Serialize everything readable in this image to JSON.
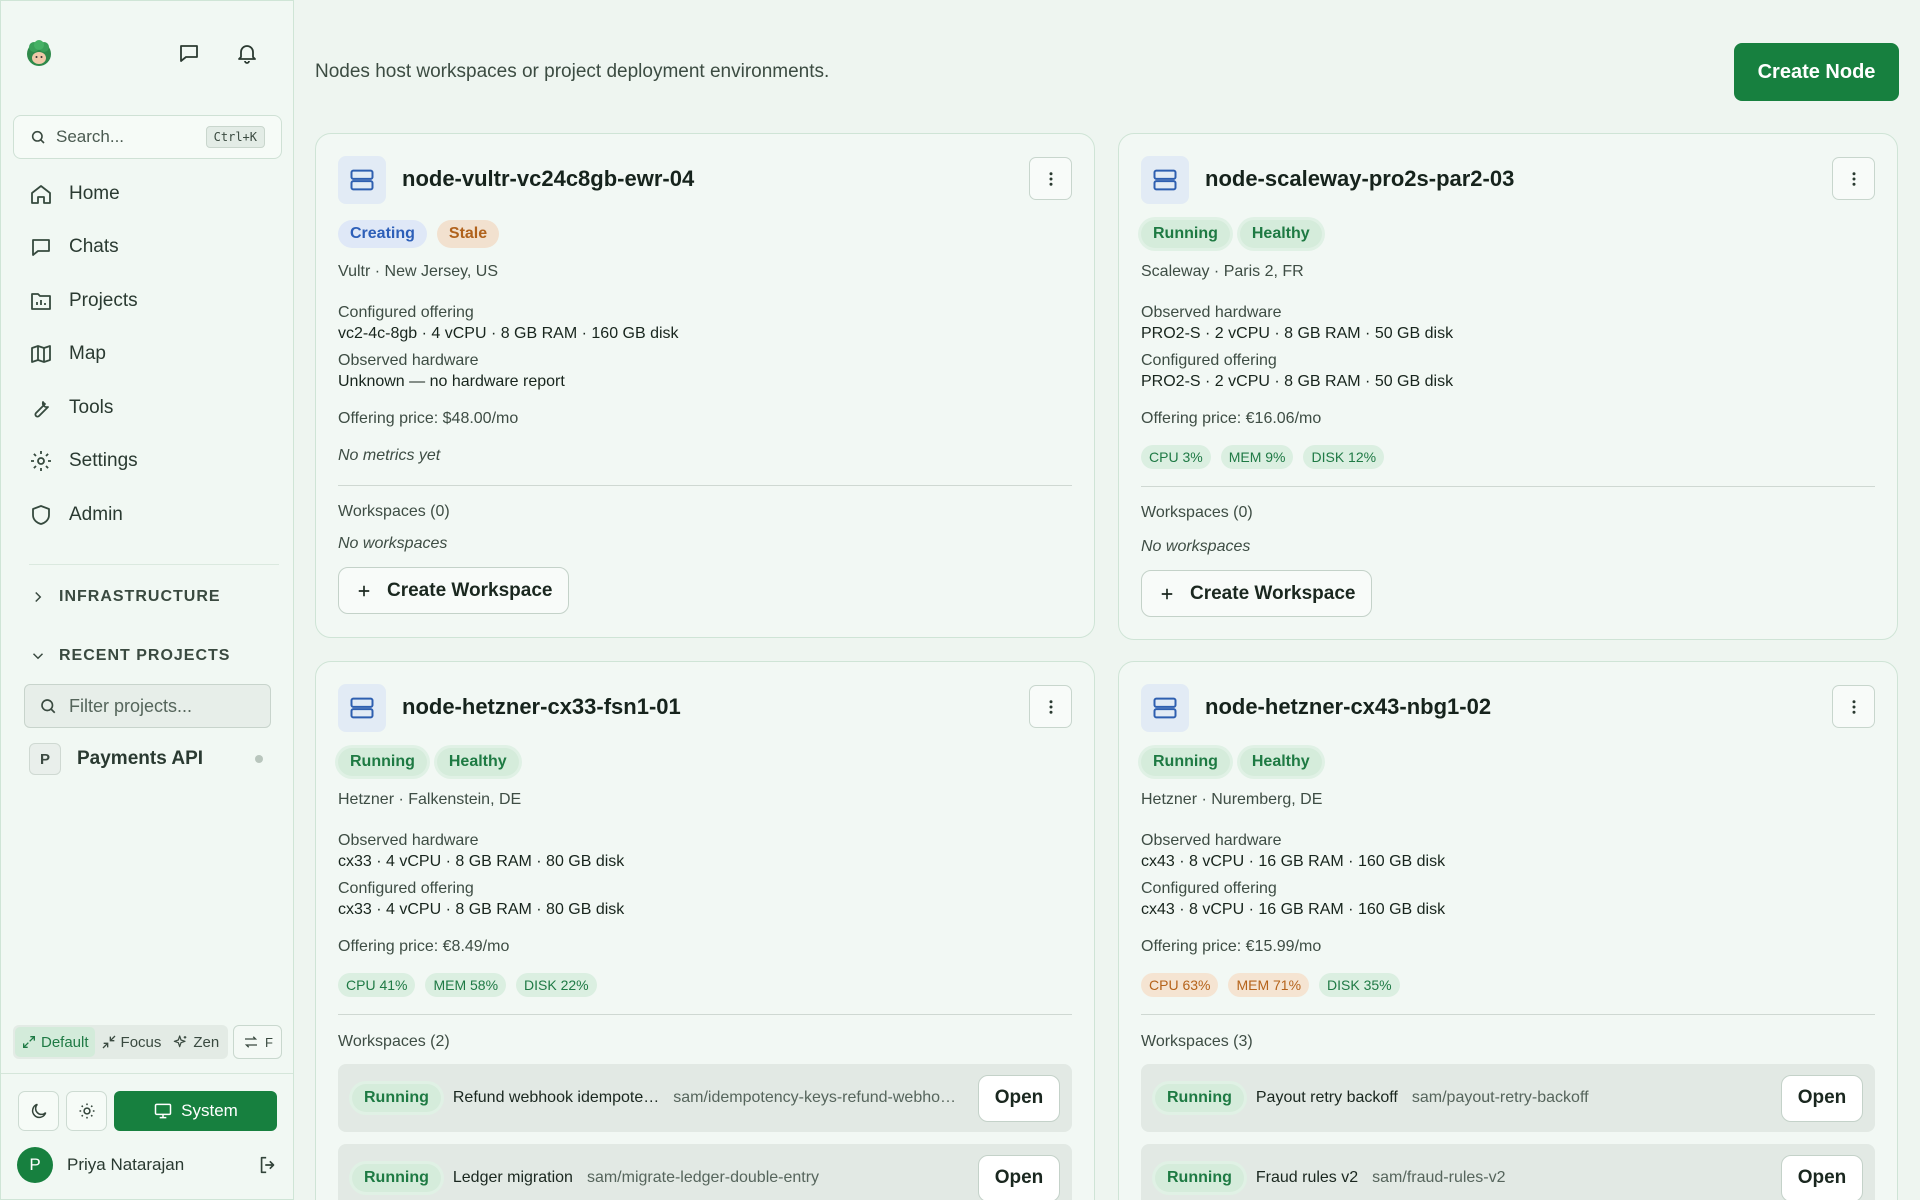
{
  "header": {
    "subtitle": "Nodes host workspaces or project deployment environments.",
    "create_node_label": "Create Node"
  },
  "sidebar": {
    "search_placeholder": "Search...",
    "search_shortcut": "Ctrl+K",
    "nav": [
      {
        "label": "Home",
        "icon": "home-icon"
      },
      {
        "label": "Chats",
        "icon": "chat-icon"
      },
      {
        "label": "Projects",
        "icon": "folder-icon"
      },
      {
        "label": "Map",
        "icon": "map-icon"
      },
      {
        "label": "Tools",
        "icon": "wrench-icon"
      },
      {
        "label": "Settings",
        "icon": "gear-icon"
      },
      {
        "label": "Admin",
        "icon": "shield-icon"
      }
    ],
    "infrastructure_label": "INFRASTRUCTURE",
    "recent_projects_label": "RECENT PROJECTS",
    "filter_placeholder": "Filter projects...",
    "project": {
      "initial": "P",
      "name": "Payments API"
    },
    "modes": [
      "Default",
      "Focus",
      "Zen"
    ],
    "swap_label": "F",
    "system_label": "System",
    "user": {
      "initial": "P",
      "name": "Priya Natarajan"
    }
  },
  "nodes": [
    {
      "name": "node-vultr-vc24c8gb-ewr-04",
      "status": "Creating",
      "health": "Stale",
      "location": "Vultr · New Jersey, US",
      "info1_label": "Configured offering",
      "info1_value": "vc2-4c-8gb · 4 vCPU · 8 GB RAM · 160 GB disk",
      "info2_label": "Observed hardware",
      "info2_value": "Unknown — no hardware report",
      "price": "Offering price: $48.00/mo",
      "no_metrics": "No metrics yet",
      "workspaces_header": "Workspaces (0)",
      "no_workspaces": "No workspaces",
      "create_workspace_label": "Create Workspace"
    },
    {
      "name": "node-scaleway-pro2s-par2-03",
      "status": "Running",
      "health": "Healthy",
      "location": "Scaleway · Paris 2, FR",
      "info1_label": "Observed hardware",
      "info1_value": "PRO2-S · 2 vCPU · 8 GB RAM · 50 GB disk",
      "info2_label": "Configured offering",
      "info2_value": "PRO2-S · 2 vCPU · 8 GB RAM · 50 GB disk",
      "price": "Offering price: €16.06/mo",
      "metrics": {
        "cpu": "CPU 3%",
        "mem": "MEM 9%",
        "disk": "DISK 12%"
      },
      "workspaces_header": "Workspaces (0)",
      "no_workspaces": "No workspaces",
      "create_workspace_label": "Create Workspace"
    },
    {
      "name": "node-hetzner-cx33-fsn1-01",
      "status": "Running",
      "health": "Healthy",
      "location": "Hetzner · Falkenstein, DE",
      "info1_label": "Observed hardware",
      "info1_value": "cx33 · 4 vCPU · 8 GB RAM · 80 GB disk",
      "info2_label": "Configured offering",
      "info2_value": "cx33 · 4 vCPU · 8 GB RAM · 80 GB disk",
      "price": "Offering price: €8.49/mo",
      "metrics": {
        "cpu": "CPU 41%",
        "mem": "MEM 58%",
        "disk": "DISK 22%"
      },
      "workspaces_header": "Workspaces (2)",
      "workspaces": [
        {
          "status": "Running",
          "title": "Refund webhook idempote…",
          "branch": "sam/idempotency-keys-refund-webho…",
          "open": "Open"
        },
        {
          "status": "Running",
          "title": "Ledger migration",
          "branch": "sam/migrate-ledger-double-entry",
          "open": "Open"
        }
      ]
    },
    {
      "name": "node-hetzner-cx43-nbg1-02",
      "status": "Running",
      "health": "Healthy",
      "location": "Hetzner · Nuremberg, DE",
      "info1_label": "Observed hardware",
      "info1_value": "cx43 · 8 vCPU · 16 GB RAM · 160 GB disk",
      "info2_label": "Configured offering",
      "info2_value": "cx43 · 8 vCPU · 16 GB RAM · 160 GB disk",
      "price": "Offering price: €15.99/mo",
      "metrics": {
        "cpu": "CPU 63%",
        "mem": "MEM 71%",
        "disk": "DISK 35%"
      },
      "workspaces_header": "Workspaces (3)",
      "workspaces": [
        {
          "status": "Running",
          "title": "Payout retry backoff",
          "branch": "sam/payout-retry-backoff",
          "open": "Open"
        },
        {
          "status": "Running",
          "title": "Fraud rules v2",
          "branch": "sam/fraud-rules-v2",
          "open": "Open"
        }
      ]
    }
  ],
  "colors": {
    "brand": "#17803f",
    "blue": "#2d5fb8",
    "orange": "#b0621c"
  }
}
